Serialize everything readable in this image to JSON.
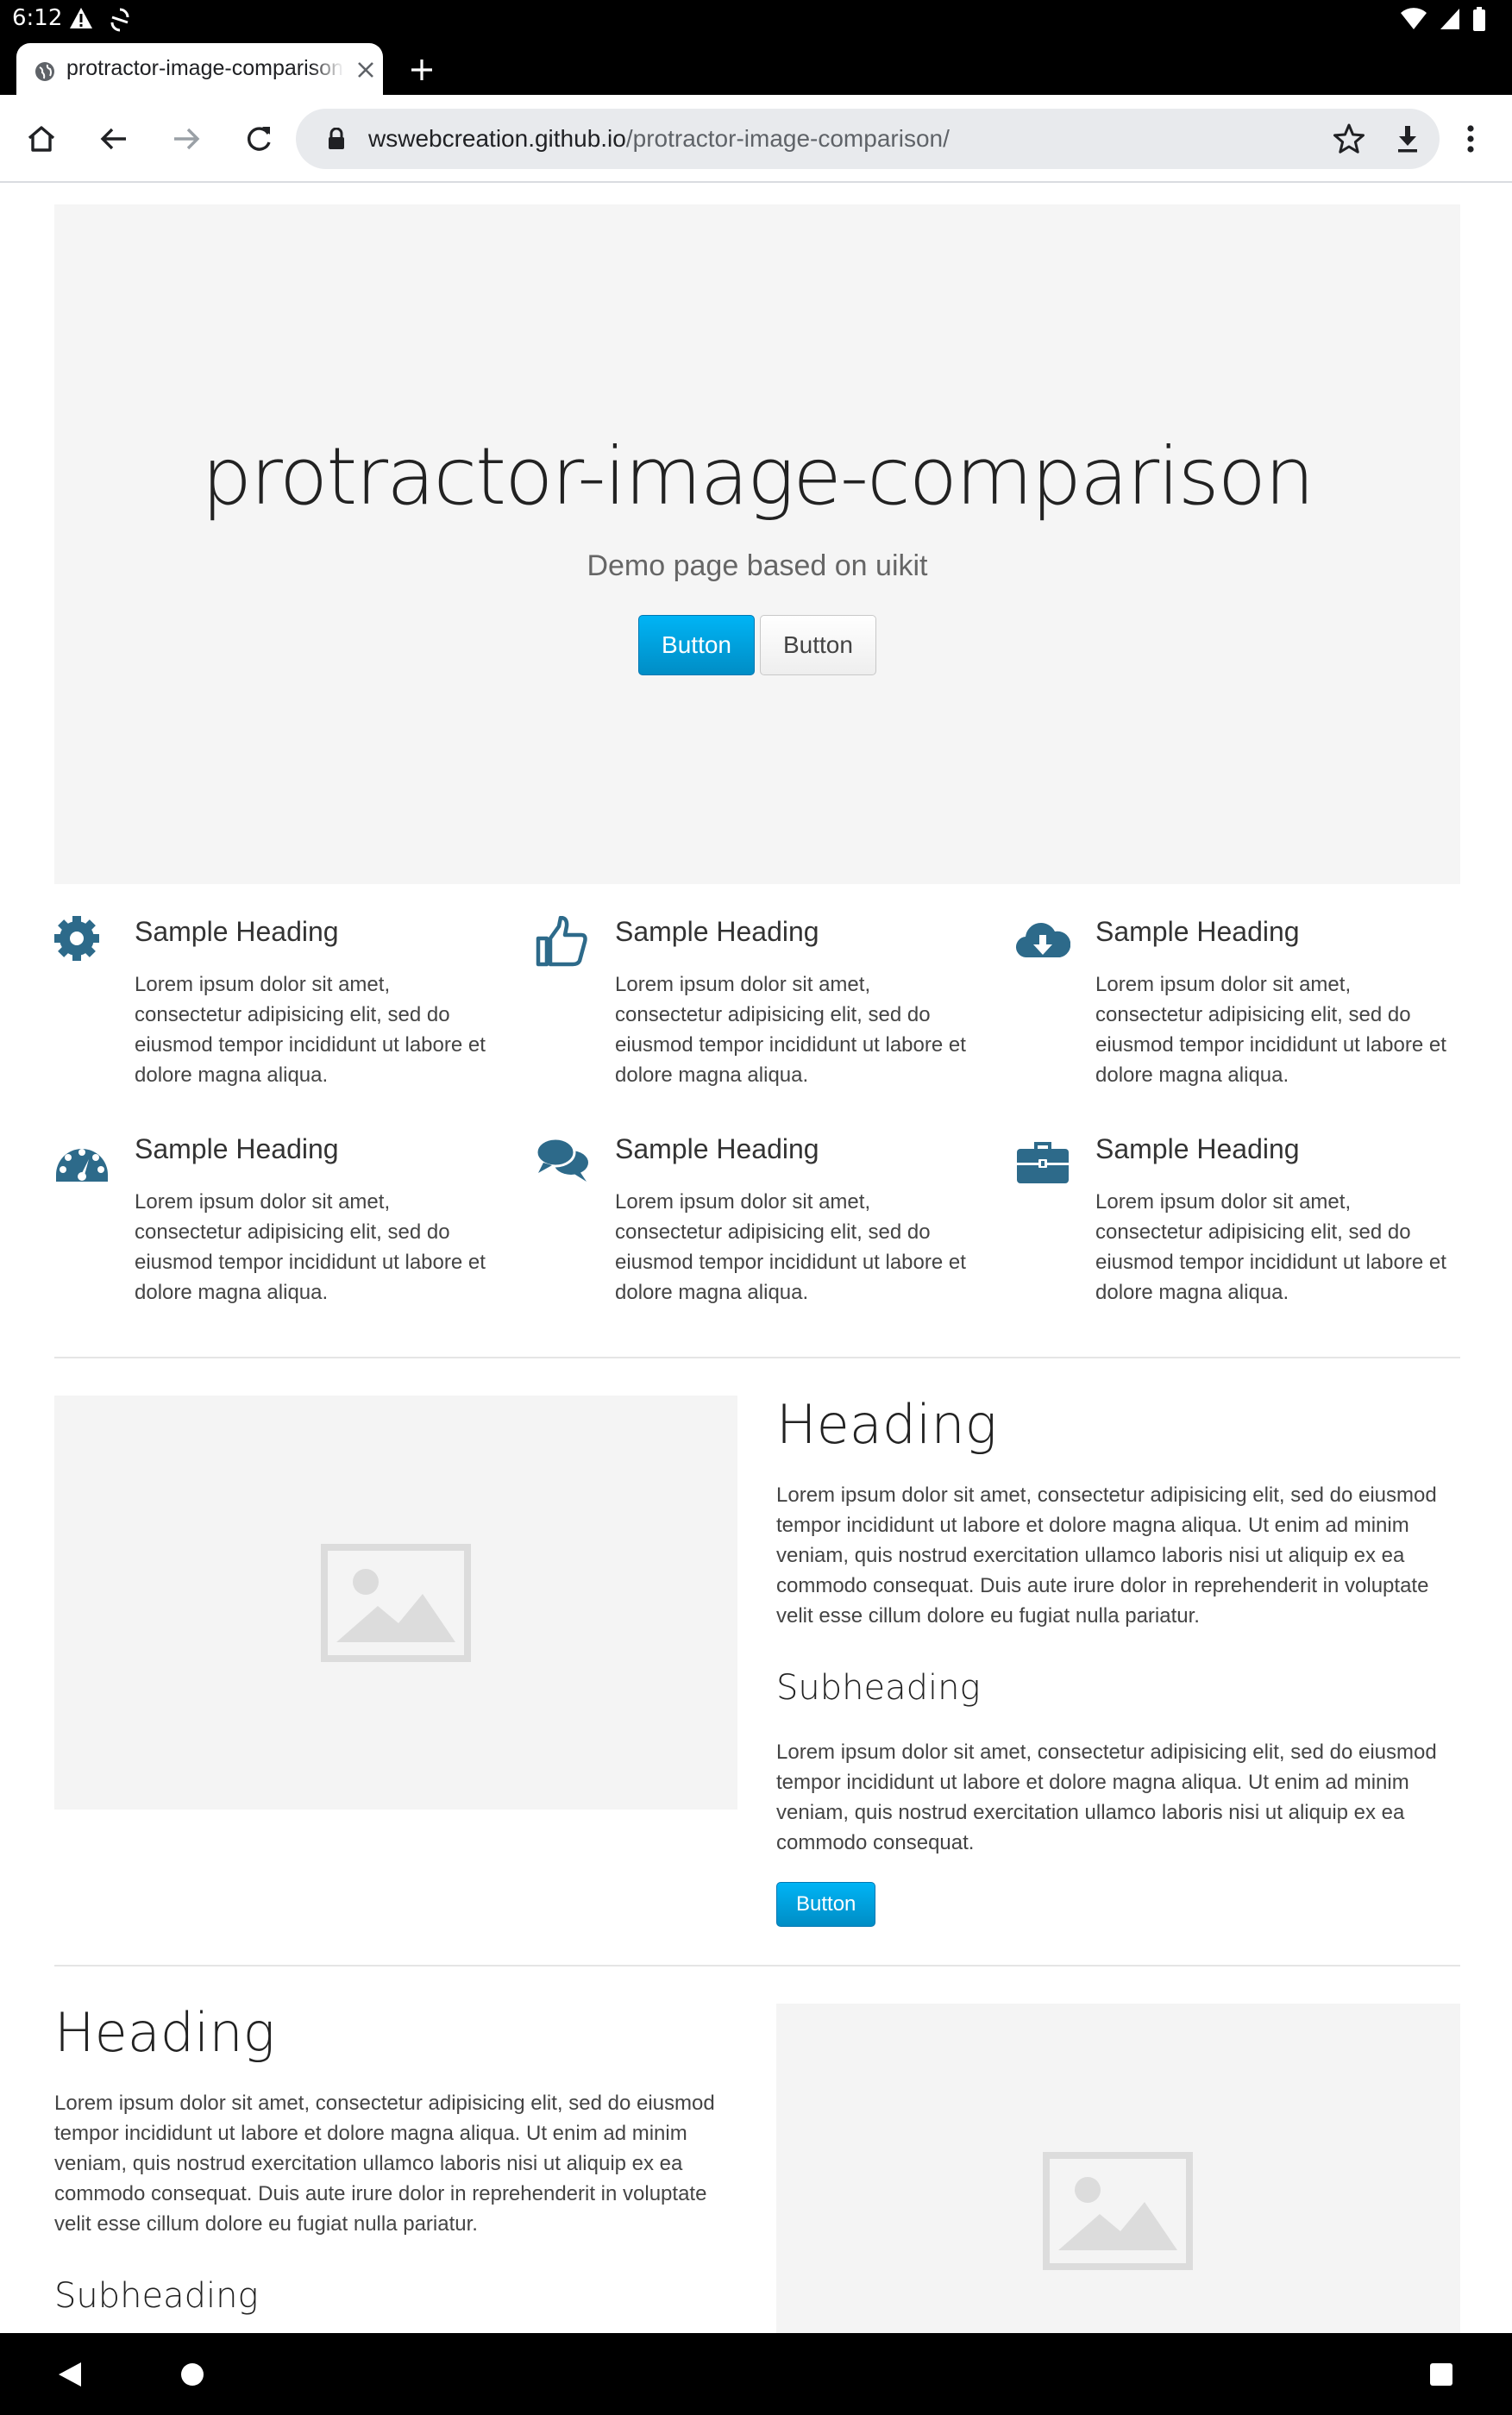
{
  "status_bar": {
    "time": "6:12",
    "left_icons": [
      "alert-icon",
      "sync-icon"
    ],
    "right_icons": [
      "wifi-icon",
      "signal-icon",
      "battery-icon"
    ]
  },
  "browser": {
    "tab": {
      "title": "protractor-image-comparison",
      "icon": "globe-icon"
    },
    "url_host": "wswebcreation.github.io",
    "url_path": "/protractor-image-comparison/",
    "toolbar_icons": [
      "home-icon",
      "back-icon",
      "forward-icon",
      "reload-icon",
      "lock-icon",
      "star-icon",
      "download-icon",
      "menu-icon"
    ]
  },
  "hero": {
    "title": "protractor-image-comparison",
    "lead": "Demo page based on uikit",
    "primary_button": "Button",
    "default_button": "Button",
    "background": "#f5f5f5"
  },
  "features": [
    {
      "icon": "gear-icon",
      "heading": "Sample Heading",
      "text": "Lorem ipsum dolor sit amet, consectetur adipisicing elit, sed do eiusmod tempor incididunt ut labore et dolore magna aliqua."
    },
    {
      "icon": "thumbs-up-icon",
      "heading": "Sample Heading",
      "text": "Lorem ipsum dolor sit amet, consectetur adipisicing elit, sed do eiusmod tempor incididunt ut labore et dolore magna aliqua."
    },
    {
      "icon": "cloud-download-icon",
      "heading": "Sample Heading",
      "text": "Lorem ipsum dolor sit amet, consectetur adipisicing elit, sed do eiusmod tempor incididunt ut labore et dolore magna aliqua."
    },
    {
      "icon": "dashboard-icon",
      "heading": "Sample Heading",
      "text": "Lorem ipsum dolor sit amet, consectetur adipisicing elit, sed do eiusmod tempor incididunt ut labore et dolore magna aliqua."
    },
    {
      "icon": "comments-icon",
      "heading": "Sample Heading",
      "text": "Lorem ipsum dolor sit amet, consectetur adipisicing elit, sed do eiusmod tempor incididunt ut labore et dolore magna aliqua."
    },
    {
      "icon": "briefcase-icon",
      "heading": "Sample Heading",
      "text": "Lorem ipsum dolor sit amet, consectetur adipisicing elit, sed do eiusmod tempor incididunt ut labore et dolore magna aliqua."
    }
  ],
  "section1": {
    "heading": "Heading",
    "text": "Lorem ipsum dolor sit amet, consectetur adipisicing elit, sed do eiusmod tempor incididunt ut labore et dolore magna aliqua. Ut enim ad minim veniam, quis nostrud exercitation ullamco laboris nisi ut aliquip ex ea commodo consequat. Duis aute irure dolor in reprehenderit in voluptate velit esse cillum dolore eu fugiat nulla pariatur.",
    "subheading": "Subheading",
    "subtext": "Lorem ipsum dolor sit amet, consectetur adipisicing elit, sed do eiusmod tempor incididunt ut labore et dolore magna aliqua. Ut enim ad minim veniam, quis nostrud exercitation ullamco laboris nisi ut aliquip ex ea commodo consequat.",
    "button": "Button"
  },
  "section2": {
    "heading": "Heading",
    "text": "Lorem ipsum dolor sit amet, consectetur adipisicing elit, sed do eiusmod tempor incididunt ut labore et dolore magna aliqua. Ut enim ad minim veniam, quis nostrud exercitation ullamco laboris nisi ut aliquip ex ea commodo consequat. Duis aute irure dolor in reprehenderit in voluptate velit esse cillum dolore eu fugiat nulla pariatur.",
    "subheading": "Subheading"
  },
  "colors": {
    "icon": "#2d6a8a",
    "primary_button": "#009dd8",
    "placeholder": "#f4f4f4",
    "image_icon": "#dcdcdc"
  },
  "nav_bar": [
    "nav-back-icon",
    "nav-home-icon",
    "nav-recents-icon"
  ]
}
